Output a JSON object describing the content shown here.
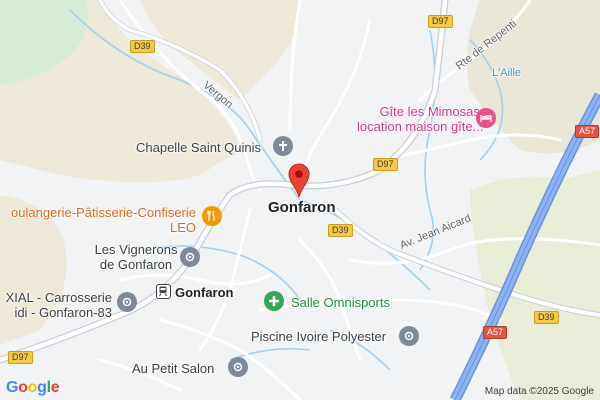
{
  "map": {
    "town_label": "Gonfaron",
    "pois": {
      "chapelle": "Chapelle Saint Quinis",
      "gite_line1": "Gîte les Mimosas:",
      "gite_line2": "location maison gîte...",
      "boulangerie_line1": "oulangerie-Pâtisserie-Confiserie",
      "boulangerie_line2": "LEO",
      "vignerons_line1": "Les Vignerons",
      "vignerons_line2": "de Gonfaron",
      "carrosserie_line1": "XIAL - Carrosserie",
      "carrosserie_line2": "idi - Gonfaron-83",
      "station": "Gonfaron",
      "salle": "Salle Omnisports",
      "piscine": "Piscine Ivoire Polyester",
      "petit_salon": "Au Petit Salon"
    },
    "streets": {
      "vergon": "Vergon",
      "rte_repenti": "Rte de Repenti",
      "aille": "L'Aille",
      "jean_aicard": "Av. Jean Aicard"
    },
    "shields": {
      "d97_top": "D97",
      "d39_topleft": "D39",
      "d97_mid": "D97",
      "d39_center": "D39",
      "d39_right": "D39",
      "a57_top": "A57",
      "a57_bottom": "A57",
      "d97_bottom": "D97"
    },
    "attribution": "Map data ©2025 Google",
    "logo": "Google",
    "colors": {
      "background": "#f1f3f4",
      "vegetation": "#e6efd6",
      "park": "#d4ecd5",
      "water": "#9fd0f0",
      "highway": "#8ab4f8",
      "pin": "#ea4335"
    }
  }
}
